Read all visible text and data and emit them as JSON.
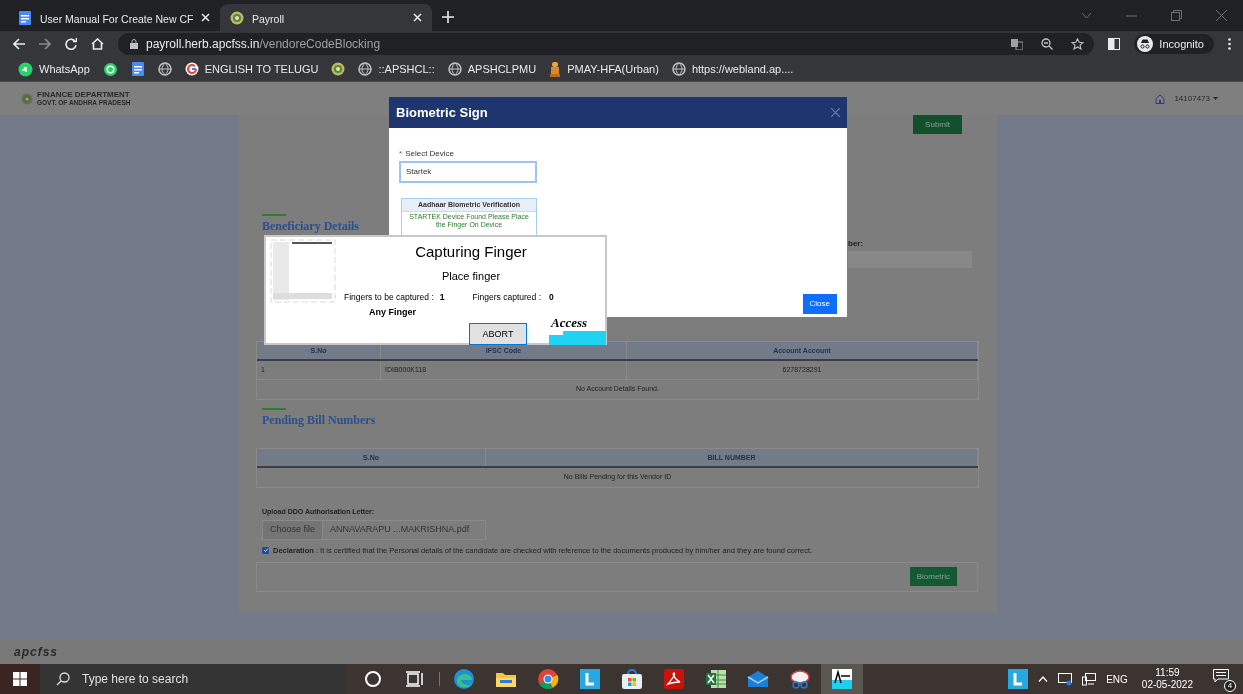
{
  "browser": {
    "tabs": [
      {
        "title": "User Manual For Create New CF",
        "kind": "doc",
        "selected": false
      },
      {
        "title": "Payroll",
        "kind": "seal",
        "selected": true
      }
    ],
    "url": {
      "host": "payroll.herb.apcfss.in",
      "path": "/vendoreCodeBlocking"
    },
    "profile": "Incognito",
    "bookmarks": [
      {
        "label": "WhatsApp",
        "kind": "whatsapp-badge"
      },
      {
        "kind": "whatsapp"
      },
      {
        "kind": "doc"
      },
      {
        "kind": "globe"
      },
      {
        "label": "ENGLISH TO TELUGU",
        "kind": "google"
      },
      {
        "kind": "seal"
      },
      {
        "label": "::APSHCL::",
        "kind": "globe"
      },
      {
        "label": "APSHCLPMU",
        "kind": "globe"
      },
      {
        "label": "PMAY-HFA(Urban)",
        "kind": "emblem"
      },
      {
        "label": "https://webland.ap....",
        "kind": "globe"
      }
    ]
  },
  "page": {
    "header": {
      "org": "FINANCE DEPARTMENT",
      "org_sub": "GOVT. OF ANDHRA PRADESH",
      "user": "14107473"
    },
    "submit_button": "Submit",
    "beneficiary_heading": "Beneficiary Details",
    "field_label": "ber:",
    "account_table": {
      "columns": [
        "S.No",
        "IFSC Code",
        "Account Account"
      ],
      "rows": [
        [
          "1",
          "IDIB000K118",
          "6278728291"
        ]
      ],
      "message": "No Account Details Found."
    },
    "pending_heading": "Pending Bill Numbers",
    "bills_table": {
      "columns": [
        "S.No",
        "BILL NUMBER"
      ],
      "message": "No Bills Pending for this Vendor ID"
    },
    "upload": {
      "label": "Upload DDO Authorisation Letter:",
      "button": "Choose file",
      "filename": "ANNAVARAPU ...MAKRISHNA.pdf"
    },
    "declaration": {
      "checked": true,
      "text": "**Declaration** : It is certified that the Personal details of the candidate are checked with reference to the documents produced by him/her and they are found correct."
    },
    "biometric_button": "Biometric",
    "footer_logo": "apcfss"
  },
  "dialog": {
    "title": "Biometric Sign",
    "required_mark": "*",
    "select_label": "Select Device",
    "device": "Startek",
    "verification": {
      "title": "Aadhaar Biometric Verification",
      "message": "STARTEK Device Found Please Place the Finger On Device"
    },
    "close_button": "Close"
  },
  "capture": {
    "title": "Capturing Finger",
    "subtitle": "Place finger",
    "to_capture_label": "Fingers to be captured :",
    "to_capture_value": "1",
    "captured_label": "Fingers captured :",
    "captured_value": "0",
    "finger": "Any Finger",
    "abort_button": "ABORT",
    "logo": "Access"
  },
  "taskbar": {
    "search_placeholder": "Type here to search",
    "apps": [
      {
        "kind": "cortana",
        "selected": false
      },
      {
        "kind": "taskview",
        "selected": false
      },
      {
        "kind": "edge",
        "selected": false
      },
      {
        "kind": "files",
        "selected": false
      },
      {
        "kind": "chrome",
        "selected": false
      },
      {
        "kind": "launcher",
        "selected": false
      },
      {
        "kind": "store",
        "selected": false
      },
      {
        "kind": "pdf",
        "selected": false
      },
      {
        "kind": "excel",
        "selected": false
      },
      {
        "kind": "mail",
        "selected": false
      },
      {
        "kind": "snip",
        "selected": false
      },
      {
        "kind": "access",
        "selected": true
      }
    ],
    "language": "ENG",
    "time": "11:59",
    "date": "02-05-2022",
    "notifications": "4"
  }
}
